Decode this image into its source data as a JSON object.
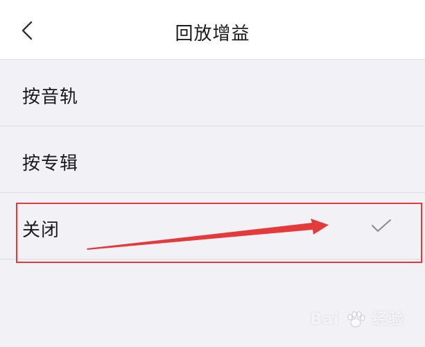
{
  "header": {
    "title": "回放增益",
    "back_icon": "chevron-left-icon"
  },
  "options": [
    {
      "label": "按音轨",
      "selected": false
    },
    {
      "label": "按专辑",
      "selected": false
    },
    {
      "label": "关闭",
      "selected": true
    }
  ],
  "annotation": {
    "color": "#e33b3b"
  },
  "watermark": {
    "text_left": "Bai",
    "text_right": "经验"
  }
}
